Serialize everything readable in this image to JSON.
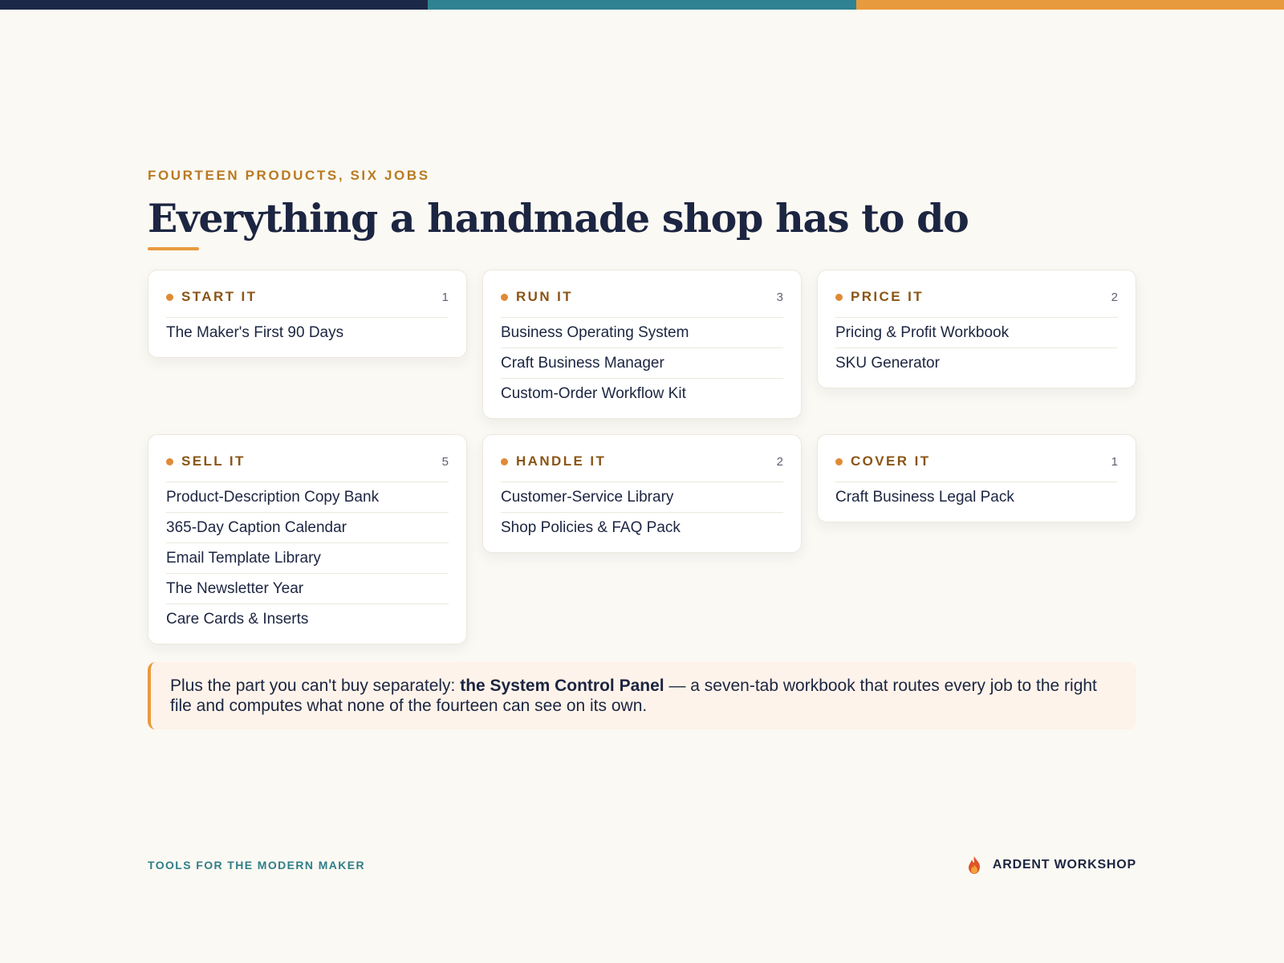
{
  "eyebrow": "FOURTEEN PRODUCTS, SIX JOBS",
  "headline": "Everything a handmade shop has to do",
  "colors": {
    "navy": "#1c2847",
    "teal": "#2f8291",
    "orange": "#e89a3e",
    "background": "#fbf9f3"
  },
  "cards": [
    {
      "title": "START IT",
      "count": "1",
      "items": [
        "The Maker's First 90 Days"
      ]
    },
    {
      "title": "RUN IT",
      "count": "3",
      "items": [
        "Business Operating System",
        "Craft Business Manager",
        "Custom-Order Workflow Kit"
      ]
    },
    {
      "title": "PRICE IT",
      "count": "2",
      "items": [
        "Pricing & Profit Workbook",
        "SKU Generator"
      ]
    },
    {
      "title": "SELL IT",
      "count": "5",
      "items": [
        "Product-Description Copy Bank",
        "365-Day Caption Calendar",
        "Email Template Library",
        "The Newsletter Year",
        "Care Cards & Inserts"
      ]
    },
    {
      "title": "HANDLE IT",
      "count": "2",
      "items": [
        "Customer-Service Library",
        "Shop Policies & FAQ Pack"
      ]
    },
    {
      "title": "COVER IT",
      "count": "1",
      "items": [
        "Craft Business Legal Pack"
      ]
    }
  ],
  "callout": {
    "lead": "Plus the part you can't buy separately: ",
    "bold": "the System Control Panel",
    "rest": " — a seven-tab workbook that routes every job to the right file and computes what none of the fourteen can see on its own."
  },
  "footer": {
    "tagline": "TOOLS FOR THE MODERN MAKER",
    "brand": "ARDENT WORKSHOP",
    "brand_icon": "flame-icon"
  }
}
